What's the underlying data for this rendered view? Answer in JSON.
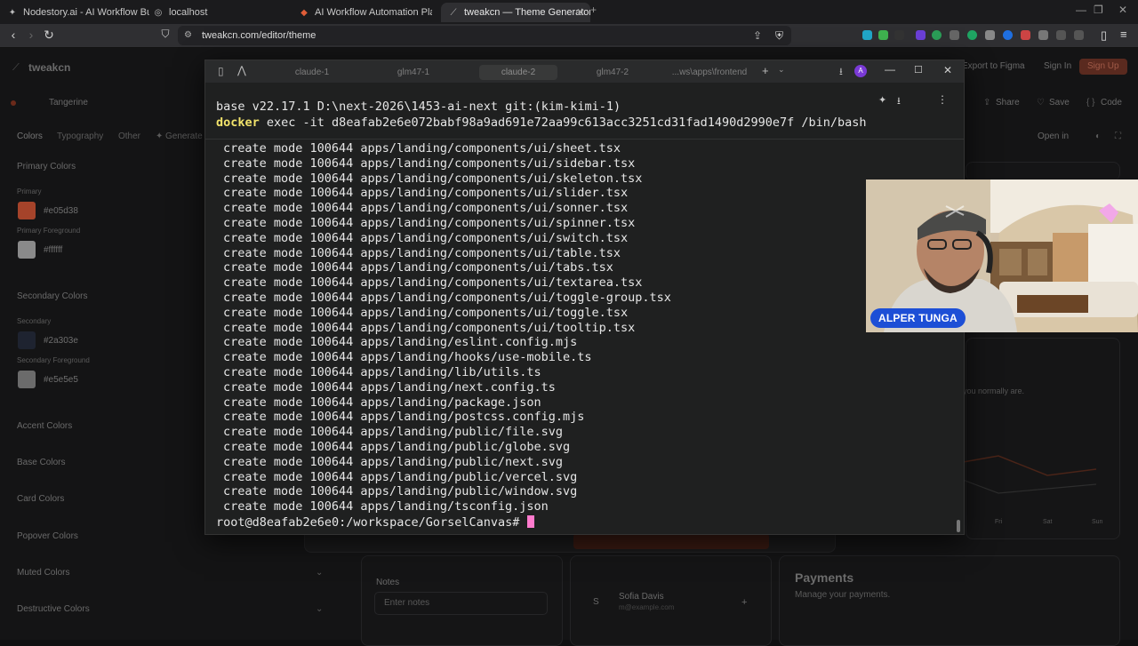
{
  "browser": {
    "tabs": [
      {
        "label": "Nodestory.ai - AI Workflow Builder",
        "icon": "nodestory-icon"
      },
      {
        "label": "localhost",
        "icon": "globe-icon"
      },
      {
        "label": "AI Workflow Automation Platform &",
        "icon": "app-icon"
      },
      {
        "label": "tweakcn — Theme Generator fo",
        "icon": "tweakcn-icon"
      }
    ],
    "url": "tweakcn.com/editor/theme"
  },
  "app": {
    "logo": "tweakcn",
    "theme_name": "Tangerine",
    "header_links": [
      "Export to Figma",
      "Sign In",
      "Sign Up"
    ],
    "tabs": [
      "Colors",
      "Typography",
      "Other",
      "Generate"
    ],
    "actions": [
      "Share",
      "Save",
      "Code"
    ],
    "open_in": "Open in",
    "primary_colors": {
      "title": "Primary Colors",
      "primary_label": "Primary",
      "primary_hex": "#e05d38",
      "primary_color": "#a5432a",
      "fg_label": "Primary Foreground",
      "fg_hex": "#ffffff",
      "fg_color": "#8a8a8a"
    },
    "secondary_colors": {
      "title": "Secondary Colors",
      "secondary_label": "Secondary",
      "secondary_hex": "#2a303e",
      "fg_label": "Secondary Foreground",
      "fg_hex": "#e5e5e5",
      "fg_color": "#6b6b6b"
    },
    "sections": [
      "Accent Colors",
      "Base Colors",
      "Card Colors",
      "Popover Colors",
      "Muted Colors",
      "Destructive Colors"
    ],
    "notes_label": "Notes",
    "notes_placeholder": "Enter notes",
    "contact_name": "Sofia Davis",
    "contact_email": "m@example.com",
    "payments_title": "Payments",
    "payments_sub": "Manage your payments.",
    "normally_text": "you normally are.",
    "days": [
      "Fri",
      "Sat",
      "Sun"
    ]
  },
  "terminal": {
    "tabs": [
      "claude-1",
      "glm47-1",
      "claude-2",
      "glm47-2",
      "...ws\\apps\\frontend"
    ],
    "prompt_info": "base v22.17.1 D:\\next-2026\\1453-ai-next git:(kim-kimi-1)",
    "command_word": "docker",
    "command_rest": " exec -it d8eafab2e6e072babf98a9ad691e72aa99c613acc3251cd31fad1490d2990e7f /bin/bash",
    "lines": [
      "create mode 100644 apps/landing/components/ui/sheet.tsx",
      "create mode 100644 apps/landing/components/ui/sidebar.tsx",
      "create mode 100644 apps/landing/components/ui/skeleton.tsx",
      "create mode 100644 apps/landing/components/ui/slider.tsx",
      "create mode 100644 apps/landing/components/ui/sonner.tsx",
      "create mode 100644 apps/landing/components/ui/spinner.tsx",
      "create mode 100644 apps/landing/components/ui/switch.tsx",
      "create mode 100644 apps/landing/components/ui/table.tsx",
      "create mode 100644 apps/landing/components/ui/tabs.tsx",
      "create mode 100644 apps/landing/components/ui/textarea.tsx",
      "create mode 100644 apps/landing/components/ui/toggle-group.tsx",
      "create mode 100644 apps/landing/components/ui/toggle.tsx",
      "create mode 100644 apps/landing/components/ui/tooltip.tsx",
      "create mode 100644 apps/landing/eslint.config.mjs",
      "create mode 100644 apps/landing/hooks/use-mobile.ts",
      "create mode 100644 apps/landing/lib/utils.ts",
      "create mode 100644 apps/landing/next.config.ts",
      "create mode 100644 apps/landing/package.json",
      "create mode 100644 apps/landing/postcss.config.mjs",
      "create mode 100644 apps/landing/public/file.svg",
      "create mode 100644 apps/landing/public/globe.svg",
      "create mode 100644 apps/landing/public/next.svg",
      "create mode 100644 apps/landing/public/vercel.svg",
      "create mode 100644 apps/landing/public/window.svg",
      "create mode 100644 apps/landing/tsconfig.json"
    ],
    "final_prompt": "root@d8eafab2e6e0:/workspace/GorselCanvas# ",
    "colors": {
      "command": "#f2e36b",
      "cursor": "#ff7bcd"
    }
  },
  "webcam": {
    "name": "ALPER TUNGA"
  }
}
